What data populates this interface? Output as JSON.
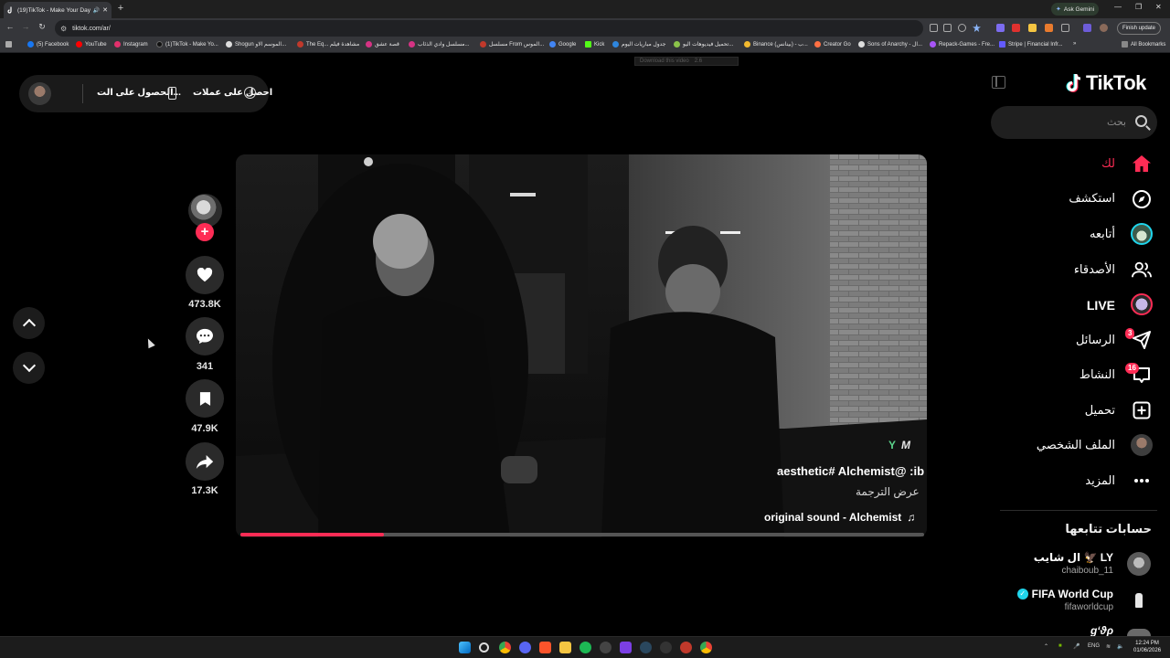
{
  "browser": {
    "tab_title": "(19)TikTok - Make Your Day",
    "new_tab": "+",
    "ask_gemini": "Ask Gemini",
    "url": "tiktok.com/ar/",
    "finish_update": "Finish update",
    "all_bookmarks": "All Bookmarks",
    "bookmarks": [
      "(5) Facebook",
      "YouTube",
      "Instagram",
      "(1)TikTok - Make Yo...",
      "Shogun الموسم الاو...",
      "The Eq... مشاهدة فيلم",
      "قصة عشق",
      "مسلسل وادي الذئاب...",
      "مسلسل From الموس...",
      "Google",
      "Kick",
      "جدول مباريات اليوم",
      "تحميل فيديوهات اليو...",
      "Binance (بينانس) - ب...",
      "Creator Go",
      "Sons of Anarchy - ال...",
      "Repack-Games - Fre...",
      "Stripe | Financial Infr..."
    ],
    "download_hint": "Download this video",
    "download_size": "2.6"
  },
  "topbar": {
    "get_coins": "احصل على عملات",
    "get_app": "الحصول على الت..."
  },
  "actions": {
    "likes": "473.8K",
    "comments": "341",
    "saves": "47.9K",
    "shares": "17.3K"
  },
  "video": {
    "watermark": "M",
    "caption": "aesthetic# Alchemist@ :ib",
    "translate": "عرض الترجمة",
    "sound": "original sound - Alchemist",
    "progress": 0.21
  },
  "sidebar": {
    "logo": "TikTok",
    "search_placeholder": "بحث",
    "nav": [
      {
        "label": "لك",
        "icon": "home-icon",
        "active": true
      },
      {
        "label": "استكشف",
        "icon": "compass-icon"
      },
      {
        "label": "أتابعه",
        "icon": "following-avatar-icon"
      },
      {
        "label": "الأصدقاء",
        "icon": "friends-icon"
      },
      {
        "label": "LIVE",
        "icon": "live-icon"
      },
      {
        "label": "الرسائل",
        "icon": "messages-icon",
        "badge": "3"
      },
      {
        "label": "النشاط",
        "icon": "activity-icon",
        "badge": "16"
      },
      {
        "label": "تحميل",
        "icon": "upload-icon"
      },
      {
        "label": "الملف الشخصي",
        "icon": "profile-avatar-icon"
      },
      {
        "label": "المزيد",
        "icon": "more-icon"
      }
    ],
    "following_header": "حسابات تتابعها",
    "accounts": [
      {
        "name": "ال شايب 🦅 LY",
        "handle": "chaiboub_11"
      },
      {
        "name": "FIFA World Cup",
        "handle": "fifaworldcup"
      },
      {
        "name": "ɡʻϑρ",
        "handle": ""
      }
    ]
  },
  "taskbar": {
    "lang": "ENG",
    "time": "12:24 PM",
    "date": "01/06/2026"
  },
  "colors": {
    "accent": "#fe2c55",
    "background": "#000000",
    "verified": "#20d5ec"
  }
}
